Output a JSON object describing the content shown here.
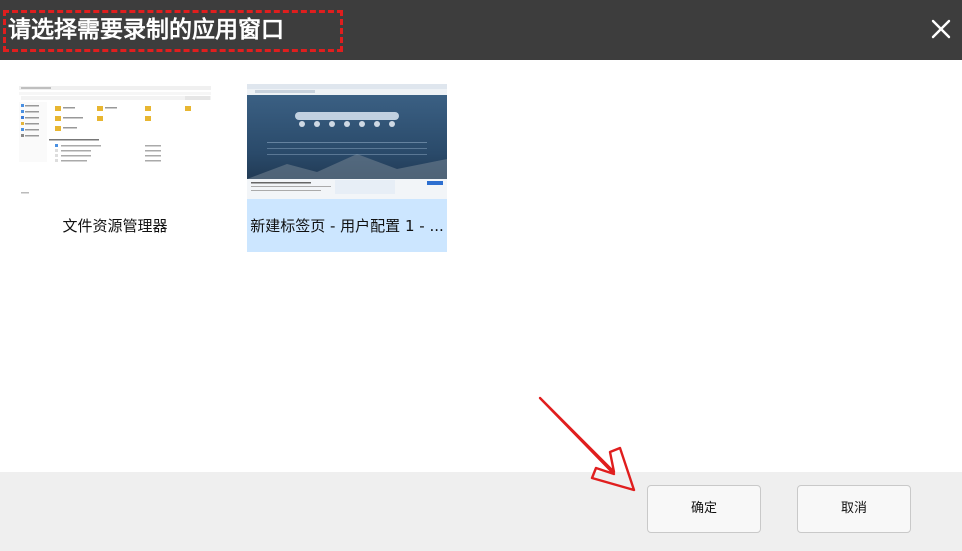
{
  "dialog": {
    "title": "请选择需要录制的应用窗口",
    "close_icon": "close-icon"
  },
  "windows": [
    {
      "label": "文件资源管理器",
      "selected": false
    },
    {
      "label": "新建标签页 - 用户配置 1 - ...",
      "selected": true
    }
  ],
  "buttons": {
    "confirm": "确定",
    "cancel": "取消"
  },
  "colors": {
    "titlebar": "#3d3d3d",
    "annotation": "#e01e1e",
    "selection": "#cce6ff",
    "footer": "#efefef"
  }
}
